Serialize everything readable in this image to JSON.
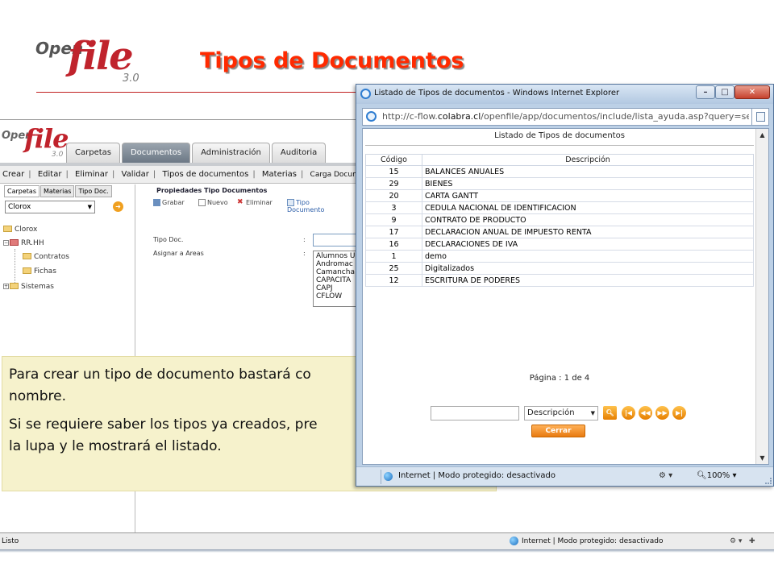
{
  "slide": {
    "logo": {
      "open": "Open",
      "file": "file",
      "version": "3.0"
    },
    "title": "Tipos de Documentos"
  },
  "app": {
    "logo": {
      "open": "Open",
      "file": "file",
      "version": "3.0"
    },
    "tabs": [
      "Carpetas",
      "Documentos",
      "Administración",
      "Auditoria"
    ],
    "active_tab": "Documentos",
    "menu": [
      "Crear",
      "Editar",
      "Eliminar",
      "Validar",
      "Tipos de documentos",
      "Materias",
      "Carga Documen"
    ],
    "left_tabs": [
      "Carpetas",
      "Materias",
      "Tipo Doc."
    ],
    "company": "Clorox",
    "tree": {
      "root": "Clorox",
      "rrhh": "RR.HH",
      "contratos": "Contratos",
      "fichas": "Fichas",
      "sistemas": "Sistemas"
    },
    "props": {
      "title": "Propiedades Tipo Documentos",
      "grabar": "Grabar",
      "nuevo": "Nuevo",
      "eliminar": "Eliminar",
      "tipo_documento": "Tipo Documento",
      "label_tipo": "Tipo Doc.",
      "label_areas": "Asignar a Areas",
      "colon": ":",
      "areas": [
        "Alumnos U",
        "Andromac",
        "Camancha",
        "CAPACITA",
        "CAPJ",
        "CFLOW"
      ]
    },
    "status": {
      "left": "Listo",
      "zone": "Internet | Modo protegido: desactivado"
    }
  },
  "callout": {
    "p1_line1": "Para crear un tipo de documento bastará co",
    "p1_line2": "nombre.",
    "p2_line1": "Si se requiere saber los tipos ya creados, pre",
    "p2_line2": "la lupa y le mostrará el listado."
  },
  "popup": {
    "title": "Listado de Tipos de documentos - Windows Internet Explorer",
    "url_prefix": "http://c-flow.",
    "url_domain": "colabra.cl",
    "url_rest": "/openfile/app/documentos/include/lista_ayuda.asp?query=se",
    "list_title": "Listado de Tipos de documentos",
    "columns": {
      "code": "Código",
      "desc": "Descripción"
    },
    "rows": [
      {
        "code": "15",
        "desc": "BALANCES ANUALES"
      },
      {
        "code": "29",
        "desc": "BIENES"
      },
      {
        "code": "20",
        "desc": "CARTA GANTT"
      },
      {
        "code": "3",
        "desc": "CEDULA NACIONAL DE IDENTIFICACION"
      },
      {
        "code": "9",
        "desc": "CONTRATO DE PRODUCTO"
      },
      {
        "code": "17",
        "desc": "DECLARACION ANUAL DE IMPUESTO RENTA"
      },
      {
        "code": "16",
        "desc": "DECLARACIONES DE IVA"
      },
      {
        "code": "1",
        "desc": "demo"
      },
      {
        "code": "25",
        "desc": "Digitalizados"
      },
      {
        "code": "12",
        "desc": "ESCRITURA DE PODERES"
      }
    ],
    "pager": "Página : 1 de 4",
    "search_field": "Descripción",
    "close_label": "Cerrar",
    "status_zone": "Internet | Modo protegido: desactivado",
    "zoom": "100%"
  },
  "colors": {
    "title_red": "#ff2a00",
    "logo_red": "#c0232c",
    "callout_bg": "#f6f2cc",
    "button_orange": "#e87a10"
  }
}
